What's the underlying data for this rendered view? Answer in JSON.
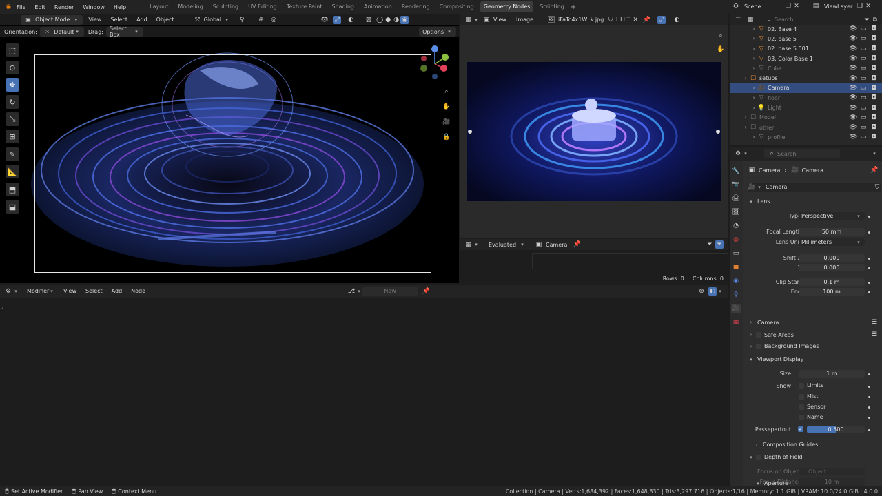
{
  "menu": [
    "File",
    "Edit",
    "Render",
    "Window",
    "Help"
  ],
  "workspaces": [
    {
      "label": "Layout",
      "active": false
    },
    {
      "label": "Modeling",
      "active": false
    },
    {
      "label": "Sculpting",
      "active": false
    },
    {
      "label": "UV Editing",
      "active": false
    },
    {
      "label": "Texture Paint",
      "active": false
    },
    {
      "label": "Shading",
      "active": false
    },
    {
      "label": "Animation",
      "active": false
    },
    {
      "label": "Rendering",
      "active": false
    },
    {
      "label": "Compositing",
      "active": false
    },
    {
      "label": "Geometry Nodes",
      "active": true
    },
    {
      "label": "Scripting",
      "active": false
    }
  ],
  "add_workspace": "+",
  "scene": "Scene",
  "view_layer": "ViewLayer",
  "viewport": {
    "mode": "Object Mode",
    "menus": [
      "View",
      "Select",
      "Add",
      "Object"
    ],
    "transform": "Global",
    "orientation_label": "Orientation:",
    "orientation_value": "Default",
    "drag_label": "Drag:",
    "drag_value": "Select Box",
    "options": "Options"
  },
  "image_editor": {
    "menus": [
      "View",
      "Image"
    ],
    "filename": "iFaTo4x1WLk.jpg"
  },
  "spreadsheet": {
    "evaluated": "Evaluated",
    "object": "Camera",
    "rows": "Rows: 0",
    "columns": "Columns: 0"
  },
  "node_editor": {
    "type": "Modifier",
    "menus": [
      "View",
      "Select",
      "Add",
      "Node"
    ],
    "new_label": "New"
  },
  "outliner": {
    "search_placeholder": "Search",
    "items": [
      {
        "label": "02. Base 4",
        "muted": false,
        "selected": false
      },
      {
        "label": "02. base 5",
        "muted": false,
        "selected": false
      },
      {
        "label": "02. base 5.001",
        "muted": false,
        "selected": false
      },
      {
        "label": "03. Color Base 1",
        "muted": false,
        "selected": false
      },
      {
        "label": "Cube",
        "muted": true,
        "selected": false
      },
      {
        "label": "setups",
        "muted": false,
        "selected": false
      },
      {
        "label": "Camera",
        "muted": false,
        "selected": true
      },
      {
        "label": "floor",
        "muted": true,
        "selected": false
      },
      {
        "label": "Light",
        "muted": true,
        "selected": false
      },
      {
        "label": "Model",
        "muted": true,
        "selected": false
      },
      {
        "label": "other",
        "muted": true,
        "selected": false
      },
      {
        "label": "profile",
        "muted": true,
        "selected": false
      }
    ]
  },
  "properties": {
    "search_placeholder": "Search",
    "breadcrumb": [
      "Camera",
      "Camera"
    ],
    "datablock": "Camera",
    "lens": {
      "title": "Lens",
      "type_label": "Type",
      "type_value": "Perspective",
      "focal_label": "Focal Length",
      "focal_value": "50 mm",
      "unit_label": "Lens Unit",
      "unit_value": "Millimeters",
      "shiftx_label": "Shift X",
      "shiftx_value": "0.000",
      "shifty_label": "Y",
      "shifty_value": "0.000",
      "clipstart_label": "Clip Start",
      "clipstart_value": "0.1 m",
      "clipend_label": "End",
      "clipend_value": "100 m"
    },
    "camera_section": "Camera",
    "safe_areas": "Safe Areas",
    "background_images": "Background Images",
    "viewport_display": {
      "title": "Viewport Display",
      "size_label": "Size",
      "size_value": "1 m",
      "show_label": "Show",
      "limits": "Limits",
      "mist": "Mist",
      "sensor": "Sensor",
      "name": "Name",
      "passepartout_label": "Passepartout",
      "passepartout_value": "0.500",
      "passepartout_fraction": 0.5
    },
    "composition_guides": "Composition Guides",
    "dof": {
      "title": "Depth of Field",
      "focus_object_label": "Focus on Object",
      "focus_object_placeholder": "Object",
      "focus_distance_label": "Focus Distance",
      "focus_distance_value": "10 m"
    },
    "aperture": "Aperture"
  },
  "status_left": [
    "Set Active Modifier",
    "Pan View",
    "Context Menu"
  ],
  "status_right": "Collection | Camera | Verts:1,684,392 | Faces:1,648,830 | Tris:3,297,716 | Objects:1/16 | Memory: 1.1 GiB | VRAM: 10.0/24.0 GiB | 4.0.0"
}
